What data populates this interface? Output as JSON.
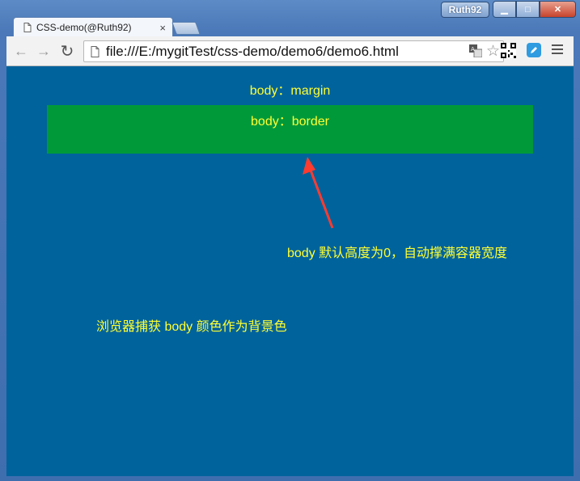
{
  "window": {
    "user_badge": "Ruth92",
    "controls": {
      "minimize": "▁",
      "maximize": "□",
      "close": "✕"
    }
  },
  "tabs": [
    {
      "title": "CSS-demo(@Ruth92)",
      "close": "×"
    }
  ],
  "toolbar": {
    "back": "←",
    "forward": "→",
    "reload": "↻",
    "url": "file:///E:/mygitTest/css-demo/demo6/demo6.html",
    "bookmark": "☆"
  },
  "page": {
    "margin_label": "body：margin",
    "border_label": "body：border",
    "height_note": "body 默认高度为0，自动撑满容器宽度",
    "bg_note": "浏览器捕获 body 颜色作为背景色"
  },
  "colors": {
    "page_bg": "#00639c",
    "body_box": "#00993a",
    "text": "#ffff33",
    "arrow": "#ff3b30"
  }
}
